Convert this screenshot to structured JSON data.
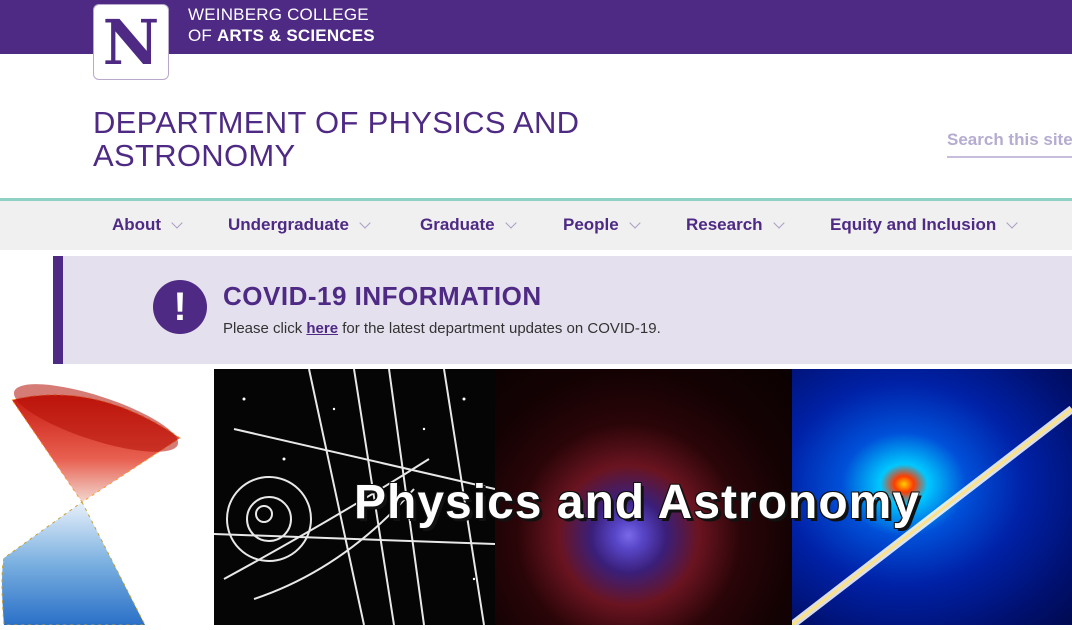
{
  "header": {
    "logo_letter": "N",
    "college_line1": "WEINBERG COLLEGE",
    "college_line2_prefix": "OF ",
    "college_line2_bold": "ARTS & SCIENCES"
  },
  "department": {
    "title_line1": "DEPARTMENT OF PHYSICS AND",
    "title_line2": "ASTRONOMY"
  },
  "search": {
    "placeholder": "Search this site"
  },
  "nav": {
    "items": [
      {
        "label": "About"
      },
      {
        "label": "Undergraduate"
      },
      {
        "label": "Graduate"
      },
      {
        "label": "People"
      },
      {
        "label": "Research"
      },
      {
        "label": "Equity and Inclusion"
      }
    ]
  },
  "covid": {
    "icon": "!",
    "title": "COVID-19 INFORMATION",
    "text_before": "Please click ",
    "link_text": "here",
    "text_after": " for the latest department updates on COVID-19."
  },
  "hero": {
    "title": "Physics and Astronomy"
  },
  "colors": {
    "brand_purple": "#4e2a84",
    "nav_accent": "#8fd1c5",
    "covid_bg": "#e4e0ee"
  }
}
